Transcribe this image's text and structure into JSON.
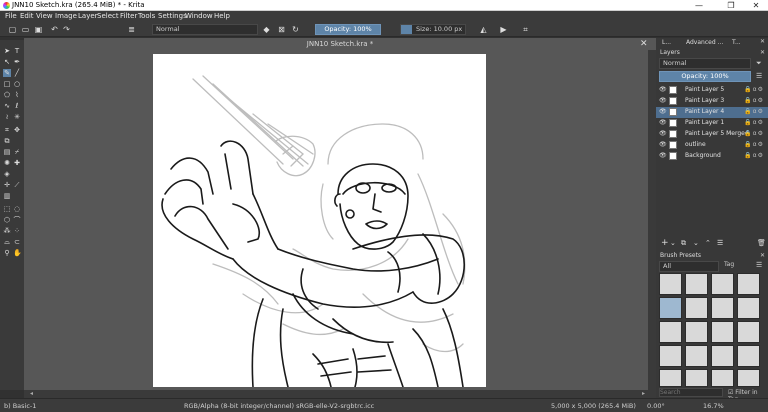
{
  "window": {
    "title": "JNN10 Sketch.kra (265.4 MiB)  * - Krita",
    "minimize": "—",
    "maximize": "❐",
    "close": "✕"
  },
  "menu": [
    "File",
    "Edit",
    "View",
    "Image",
    "Layer",
    "Select",
    "Filter",
    "Tools",
    "Settings",
    "Window",
    "Help"
  ],
  "toolbar": {
    "blend_mode": "Normal",
    "opacity": "Opacity: 100%",
    "size": "Size: 10.00 px"
  },
  "document": {
    "title": "JNN10 Sketch.kra *",
    "close": "✕"
  },
  "dock": {
    "tabs": [
      "L...",
      "Advanced ...",
      "T..."
    ],
    "layers_title": "Layers",
    "blend_mode": "Normal",
    "opacity": "Opacity:  100%",
    "layers": [
      {
        "name": "Paint Layer 5",
        "selected": false
      },
      {
        "name": "Paint Layer 3",
        "selected": false
      },
      {
        "name": "Paint Layer 4",
        "selected": true
      },
      {
        "name": "Paint Layer 1",
        "selected": false
      },
      {
        "name": "Paint Layer 5 Merged",
        "selected": false
      },
      {
        "name": "outline",
        "selected": false
      },
      {
        "name": "Background",
        "selected": false
      }
    ],
    "brush_presets_title": "Brush Presets",
    "brush_filter": "All",
    "tag_label": "Tag",
    "search_placeholder": "Search",
    "filter_in_tag": "Filter in Tag"
  },
  "status": {
    "brush": "b) Basic-1",
    "color_profile": "RGB/Alpha (8-bit integer/channel)  sRGB-elle-V2-srgbtrc.icc",
    "dimensions": "5,000 x 5,000 (265.4 MiB)",
    "rotation": "0.00°",
    "zoom": "16.7%"
  }
}
